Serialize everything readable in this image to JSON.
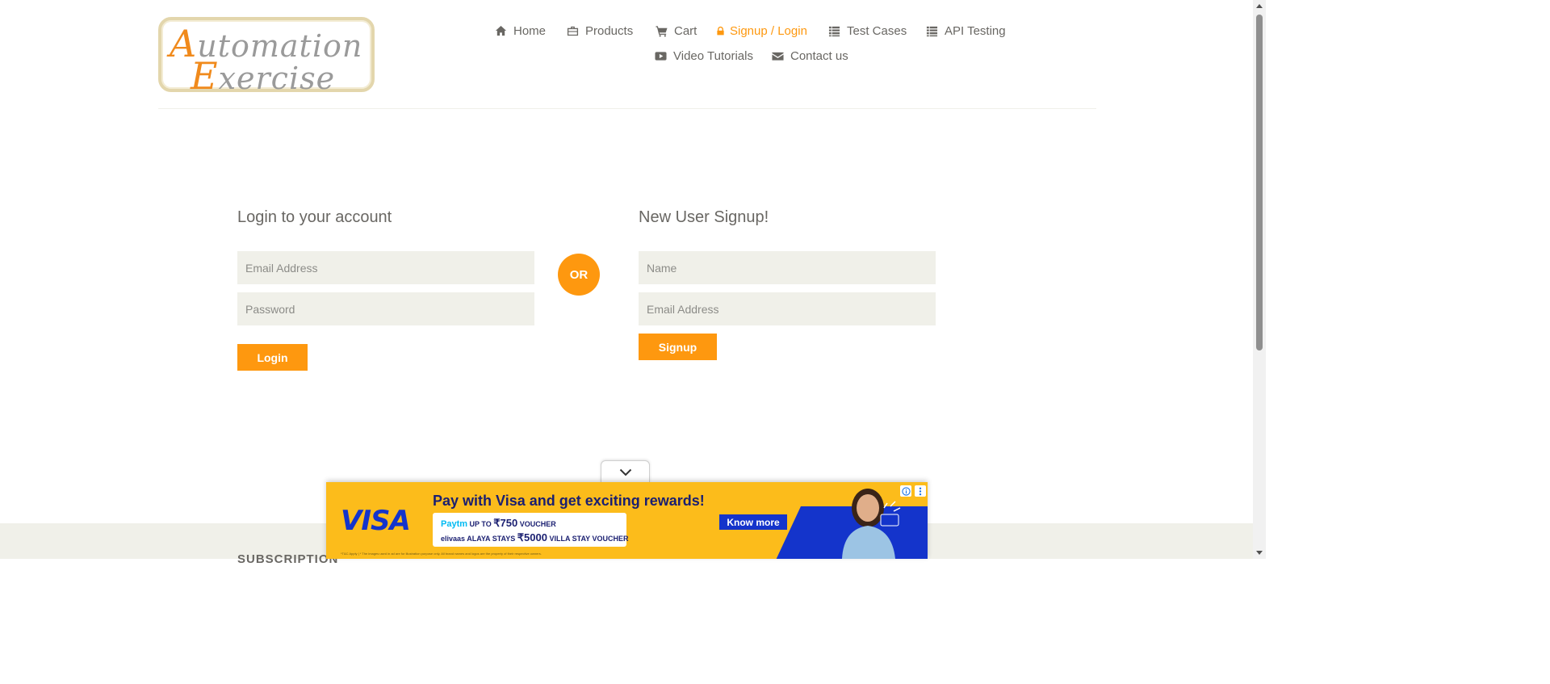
{
  "logo": {
    "line1_cap": "A",
    "line1_rest": "utomation",
    "line2_cap": "E",
    "line2_rest": "xercise"
  },
  "nav": [
    {
      "label": "Home",
      "icon": "home-icon",
      "active": false
    },
    {
      "label": "Products",
      "icon": "briefcase-icon",
      "active": false
    },
    {
      "label": "Cart",
      "icon": "cart-icon",
      "active": false
    },
    {
      "label": "Signup / Login",
      "icon": "lock-icon",
      "active": true
    },
    {
      "label": "Test Cases",
      "icon": "list-icon",
      "active": false
    },
    {
      "label": "API Testing",
      "icon": "list-icon",
      "active": false
    },
    {
      "label": "Video Tutorials",
      "icon": "youtube-icon",
      "active": false
    },
    {
      "label": "Contact us",
      "icon": "envelope-icon",
      "active": false
    }
  ],
  "login": {
    "title": "Login to your account",
    "email_placeholder": "Email Address",
    "email_value": "",
    "password_placeholder": "Password",
    "password_value": "",
    "button": "Login"
  },
  "or_label": "OR",
  "signup": {
    "title": "New User Signup!",
    "name_placeholder": "Name",
    "name_value": "",
    "email_placeholder": "Email Address",
    "email_value": "",
    "button": "Signup"
  },
  "footer": {
    "subscription_heading": "SUBSCRIPTION"
  },
  "ad": {
    "brand": "VISA",
    "headline": "Pay with Visa and get exciting rewards!",
    "voucher_line1_brand": "Paytm",
    "voucher_line1_prefix": "UP TO",
    "voucher_line1_amount": "₹750",
    "voucher_line1_suffix": "VOUCHER",
    "voucher_line2_brands": "elivaas  ALAYA STAYS",
    "voucher_line2_amount": "₹5000",
    "voucher_line2_suffix": "VILLA STAY VOUCHER",
    "cta": "Know more",
    "tnc": "*T&C Apply | * The images used in ad are for illustration purpose only. All brand names and logos are the property of their respective owners."
  },
  "colors": {
    "accent": "#fe980f",
    "field_bg": "#f0f0e9",
    "text": "#696763",
    "visa_blue": "#1434cb",
    "ad_yellow": "#fcbc1b"
  }
}
